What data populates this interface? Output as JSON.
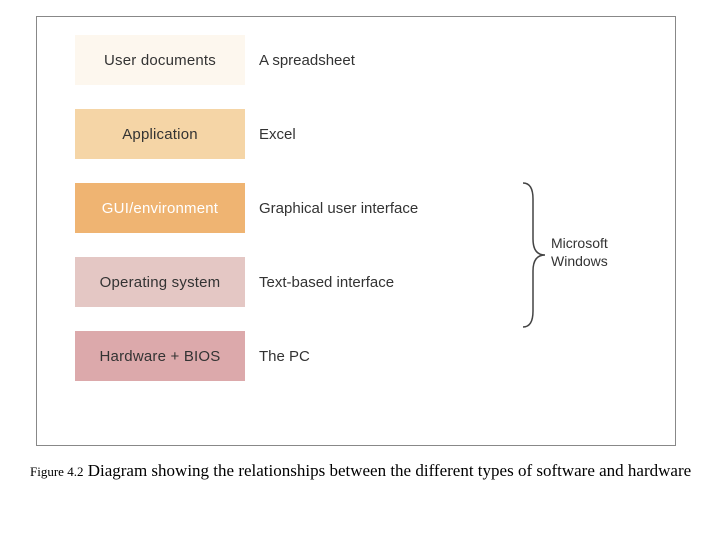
{
  "layers": [
    {
      "label": "User documents",
      "example": "A spreadsheet"
    },
    {
      "label": "Application",
      "example": "Excel"
    },
    {
      "label": "GUI/environment",
      "example": "Graphical user interface"
    },
    {
      "label": "Operating system",
      "example": "Text-based interface"
    },
    {
      "label": "Hardware + BIOS",
      "example": "The PC"
    }
  ],
  "brace_label_line1": "Microsoft",
  "brace_label_line2": "Windows",
  "caption": {
    "fignum": "Figure 4.2",
    "text": "Diagram showing the relationships between the different types of software and hardware"
  }
}
